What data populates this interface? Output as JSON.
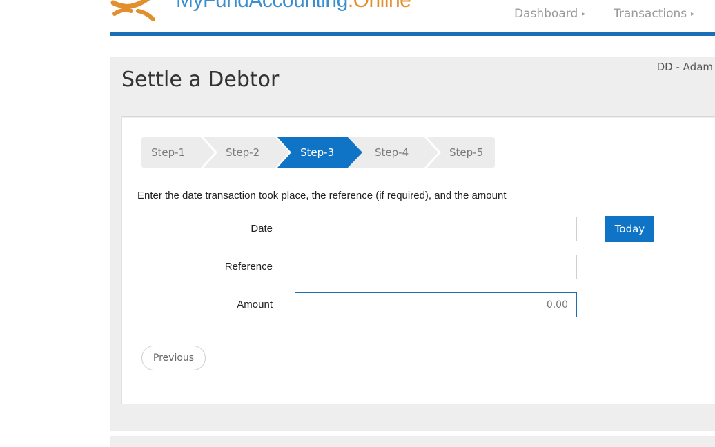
{
  "header": {
    "logo_text_main": "MyFundAccounting",
    "logo_text_suffix": ".Online",
    "nav": [
      {
        "label": "Dashboard"
      },
      {
        "label": "Transactions"
      }
    ],
    "accent_color": "#1b6fb6"
  },
  "page": {
    "title": "Settle a Debtor",
    "user": "DD - Adam"
  },
  "wizard": {
    "steps": [
      {
        "label": "Step-1",
        "active": false
      },
      {
        "label": "Step-2",
        "active": false
      },
      {
        "label": "Step-3",
        "active": true
      },
      {
        "label": "Step-4",
        "active": false
      },
      {
        "label": "Step-5",
        "active": false
      }
    ],
    "active_color": "#0f74c6",
    "inactive_color": "#ececec"
  },
  "form": {
    "instructions": "Enter the date transaction took place, the reference (if required), and the amount",
    "date_label": "Date",
    "date_value": "",
    "reference_label": "Reference",
    "reference_value": "",
    "amount_label": "Amount",
    "amount_value": "0.00",
    "today_label": "Today",
    "previous_label": "Previous"
  }
}
